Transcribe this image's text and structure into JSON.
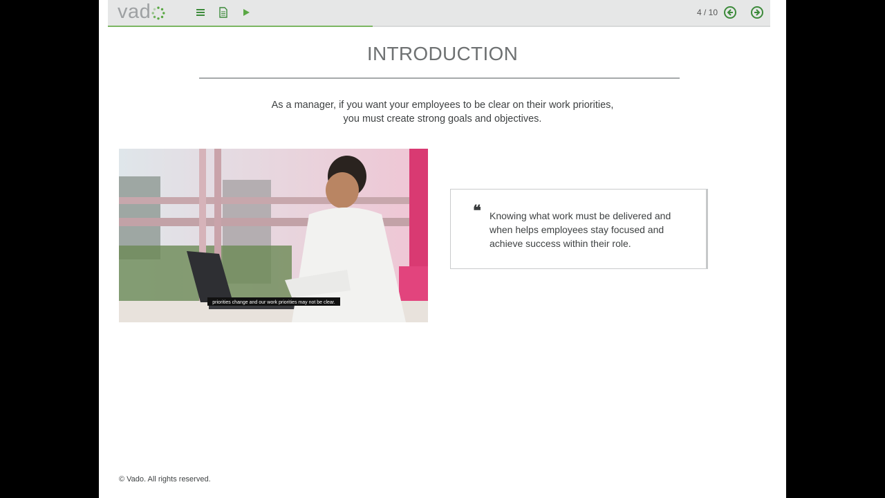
{
  "app": {
    "logo_text": "vad",
    "counter": "4 / 10",
    "progress": 0.4
  },
  "toolbar": {
    "menu_icon": "menu-icon",
    "notes_icon": "document-icon",
    "play_icon": "play-icon",
    "prev_icon": "arrow-left-circle-icon",
    "next_icon": "arrow-right-circle-icon"
  },
  "slide": {
    "title": "INTRODUCTION",
    "intro_line1": "As a manager, if you want your employees to be clear on their work priorities,",
    "intro_line2": "you must create strong goals and objectives.",
    "video_caption": "priorities change and our work priorities may not be clear.",
    "quote_mark": "❝",
    "quote": "Knowing what work must be delivered and when helps employees stay focused and achieve success within their role."
  },
  "footer": {
    "copyright": "© Vado. All rights reserved."
  },
  "colors": {
    "accent": "#7bb661",
    "nav_green": "#3c8a3a",
    "toolbar_bg": "#e6e7e7"
  }
}
